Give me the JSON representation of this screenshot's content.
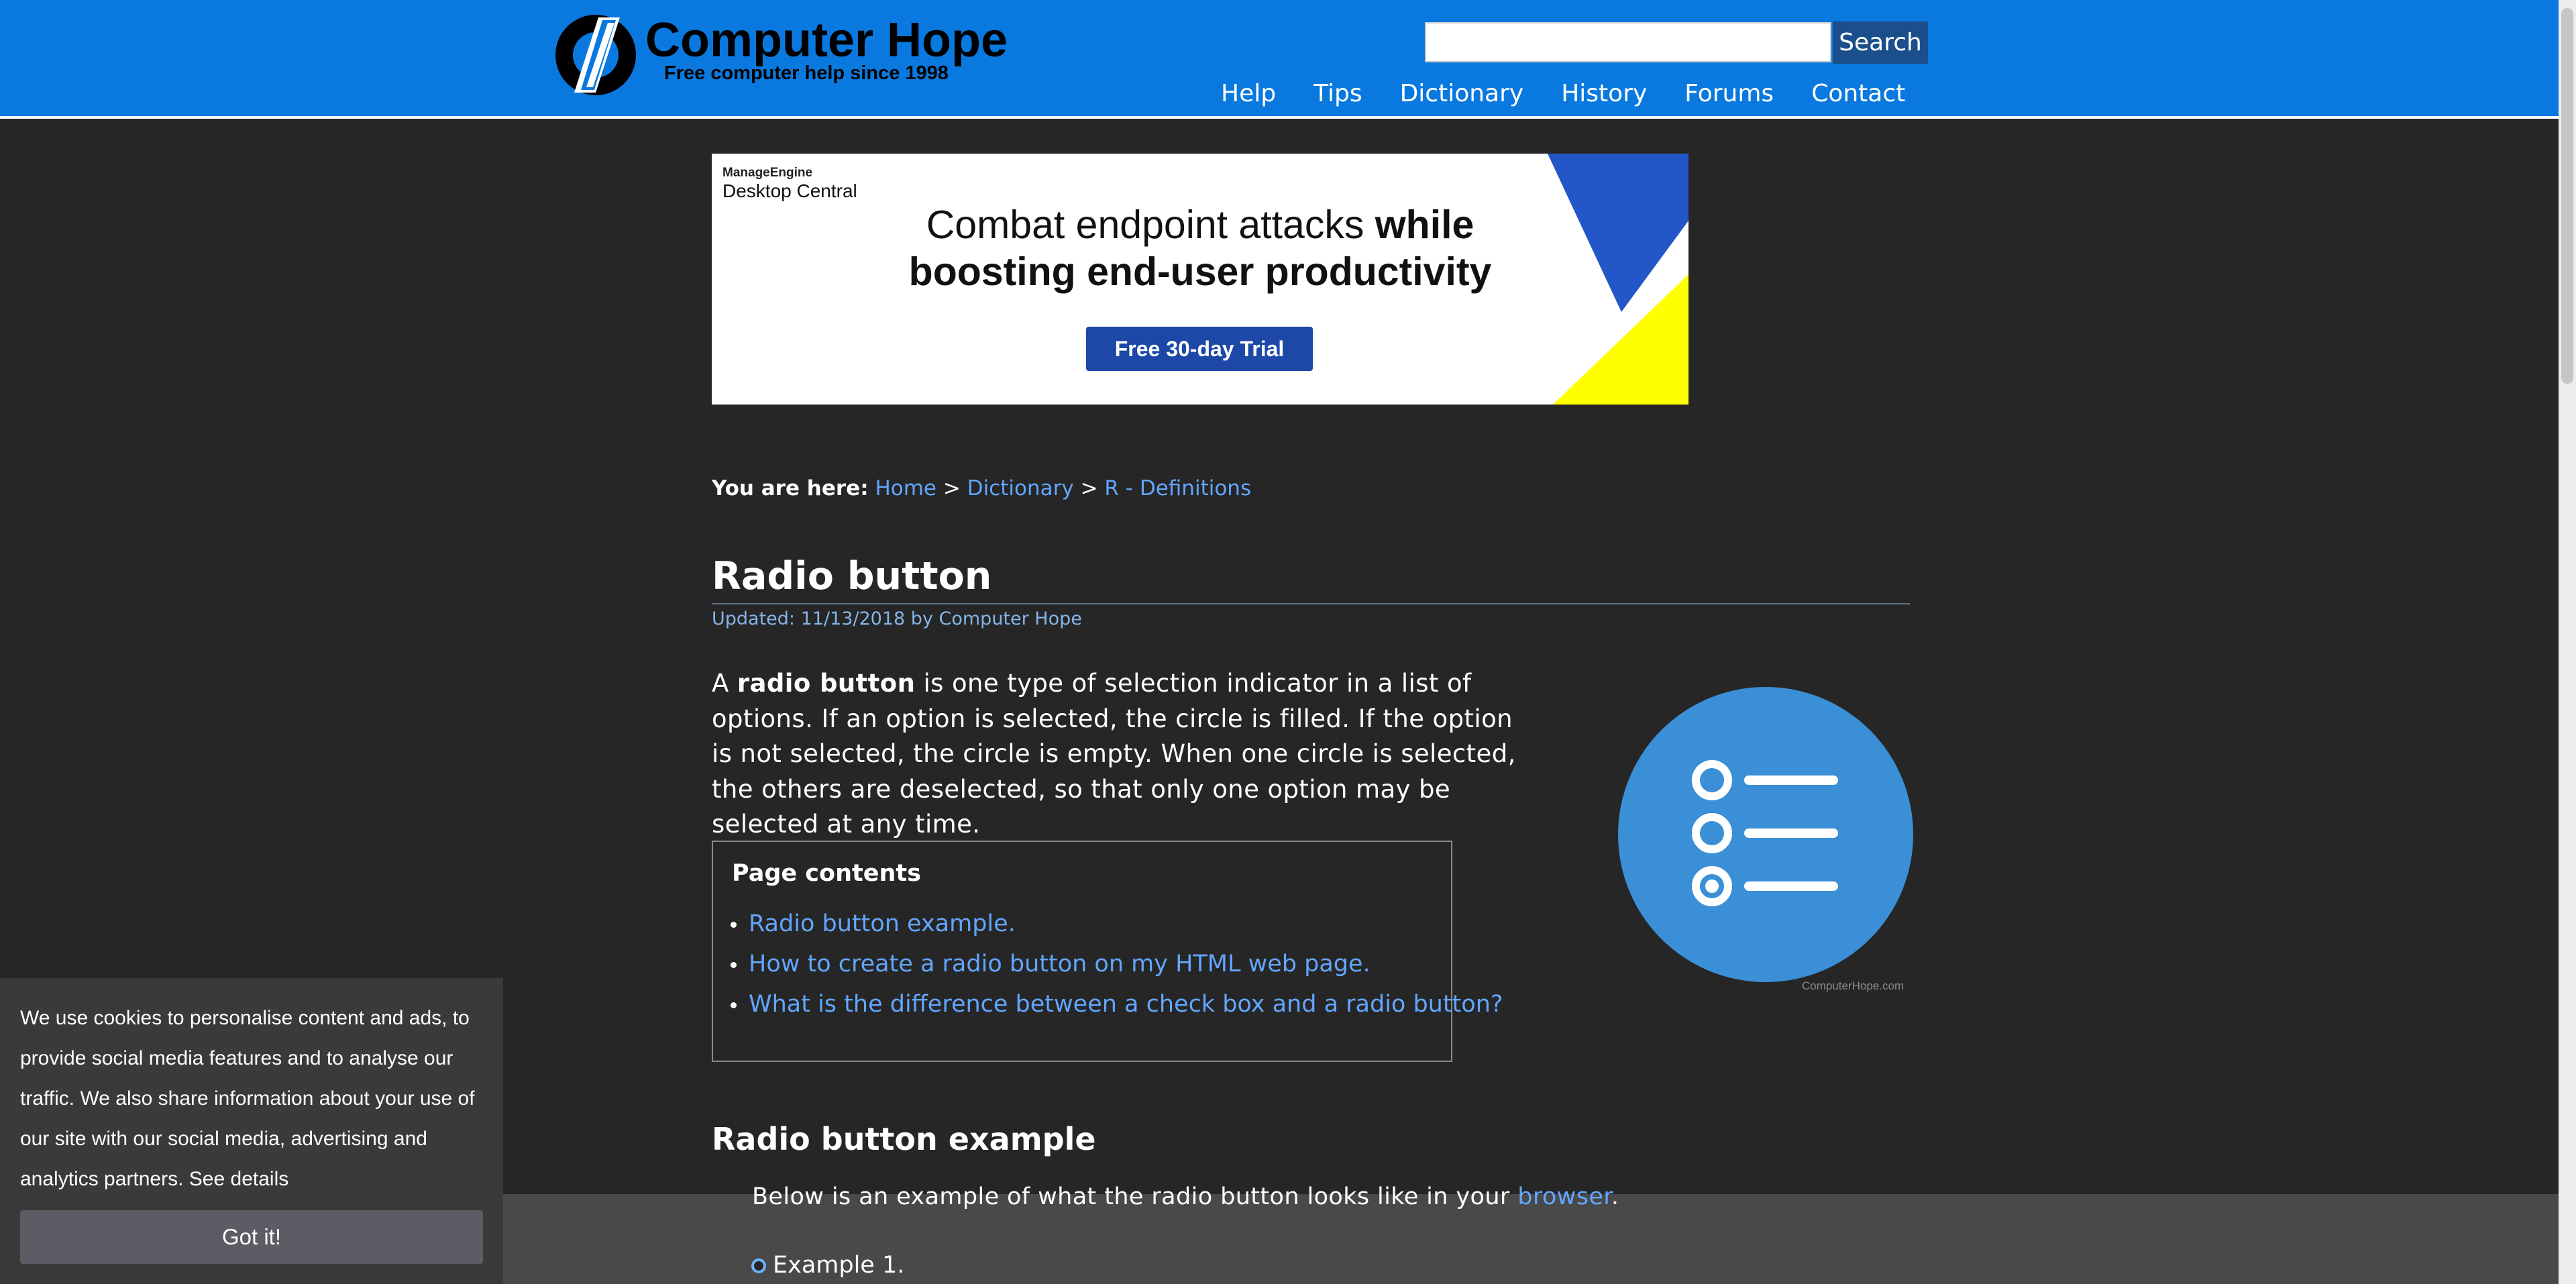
{
  "header": {
    "logo_name": "Computer Hope",
    "logo_tagline": "Free computer help since 1998",
    "search_placeholder": "",
    "search_button": "Search",
    "nav": [
      "Help",
      "Tips",
      "Dictionary",
      "History",
      "Forums",
      "Contact"
    ]
  },
  "ad": {
    "brand": "ManageEngine",
    "product": "Desktop Central",
    "adchoice": "▷✕",
    "headline_line1": "Combat endpoint attacks",
    "headline_line1_bold": "while",
    "headline_line2": "boosting end-user productivity",
    "cta": "Free 30-day Trial"
  },
  "breadcrumb": {
    "prefix": "You are here:",
    "items": [
      "Home",
      "Dictionary",
      "R - Definitions"
    ],
    "separator": ">"
  },
  "page": {
    "title": "Radio button",
    "updated": "Updated: 11/13/2018 by Computer Hope",
    "intro_before": "A ",
    "intro_bold": "radio button",
    "intro_after": " is one type of selection indicator in a list of options. If an option is selected, the circle is filled. If the option is not selected, the circle is empty. When one circle is selected, the others are deselected, so that only one option may be selected at any time.",
    "illustration_caption": "ComputerHope.com"
  },
  "toc": {
    "title": "Page contents",
    "items": [
      "Radio button example.",
      "How to create a radio button on my HTML web page.",
      "What is the difference between a check box and a radio button?"
    ]
  },
  "section": {
    "title": "Radio button example",
    "text_before": "Below is an example of what the radio button looks like in your ",
    "text_link": "browser",
    "text_after": ".",
    "example_label": "Example 1."
  },
  "cookie": {
    "text": "We use cookies to personalise content and ads, to provide social media features and to analyse our traffic. We also share information about your use of our site with our social media, advertising and analytics partners.",
    "details": "See details",
    "button": "Got it!"
  },
  "colors": {
    "header_bg": "#0a79df",
    "page_bg": "#262626",
    "link": "#62a6ff",
    "illustration": "#3b8fd6"
  }
}
